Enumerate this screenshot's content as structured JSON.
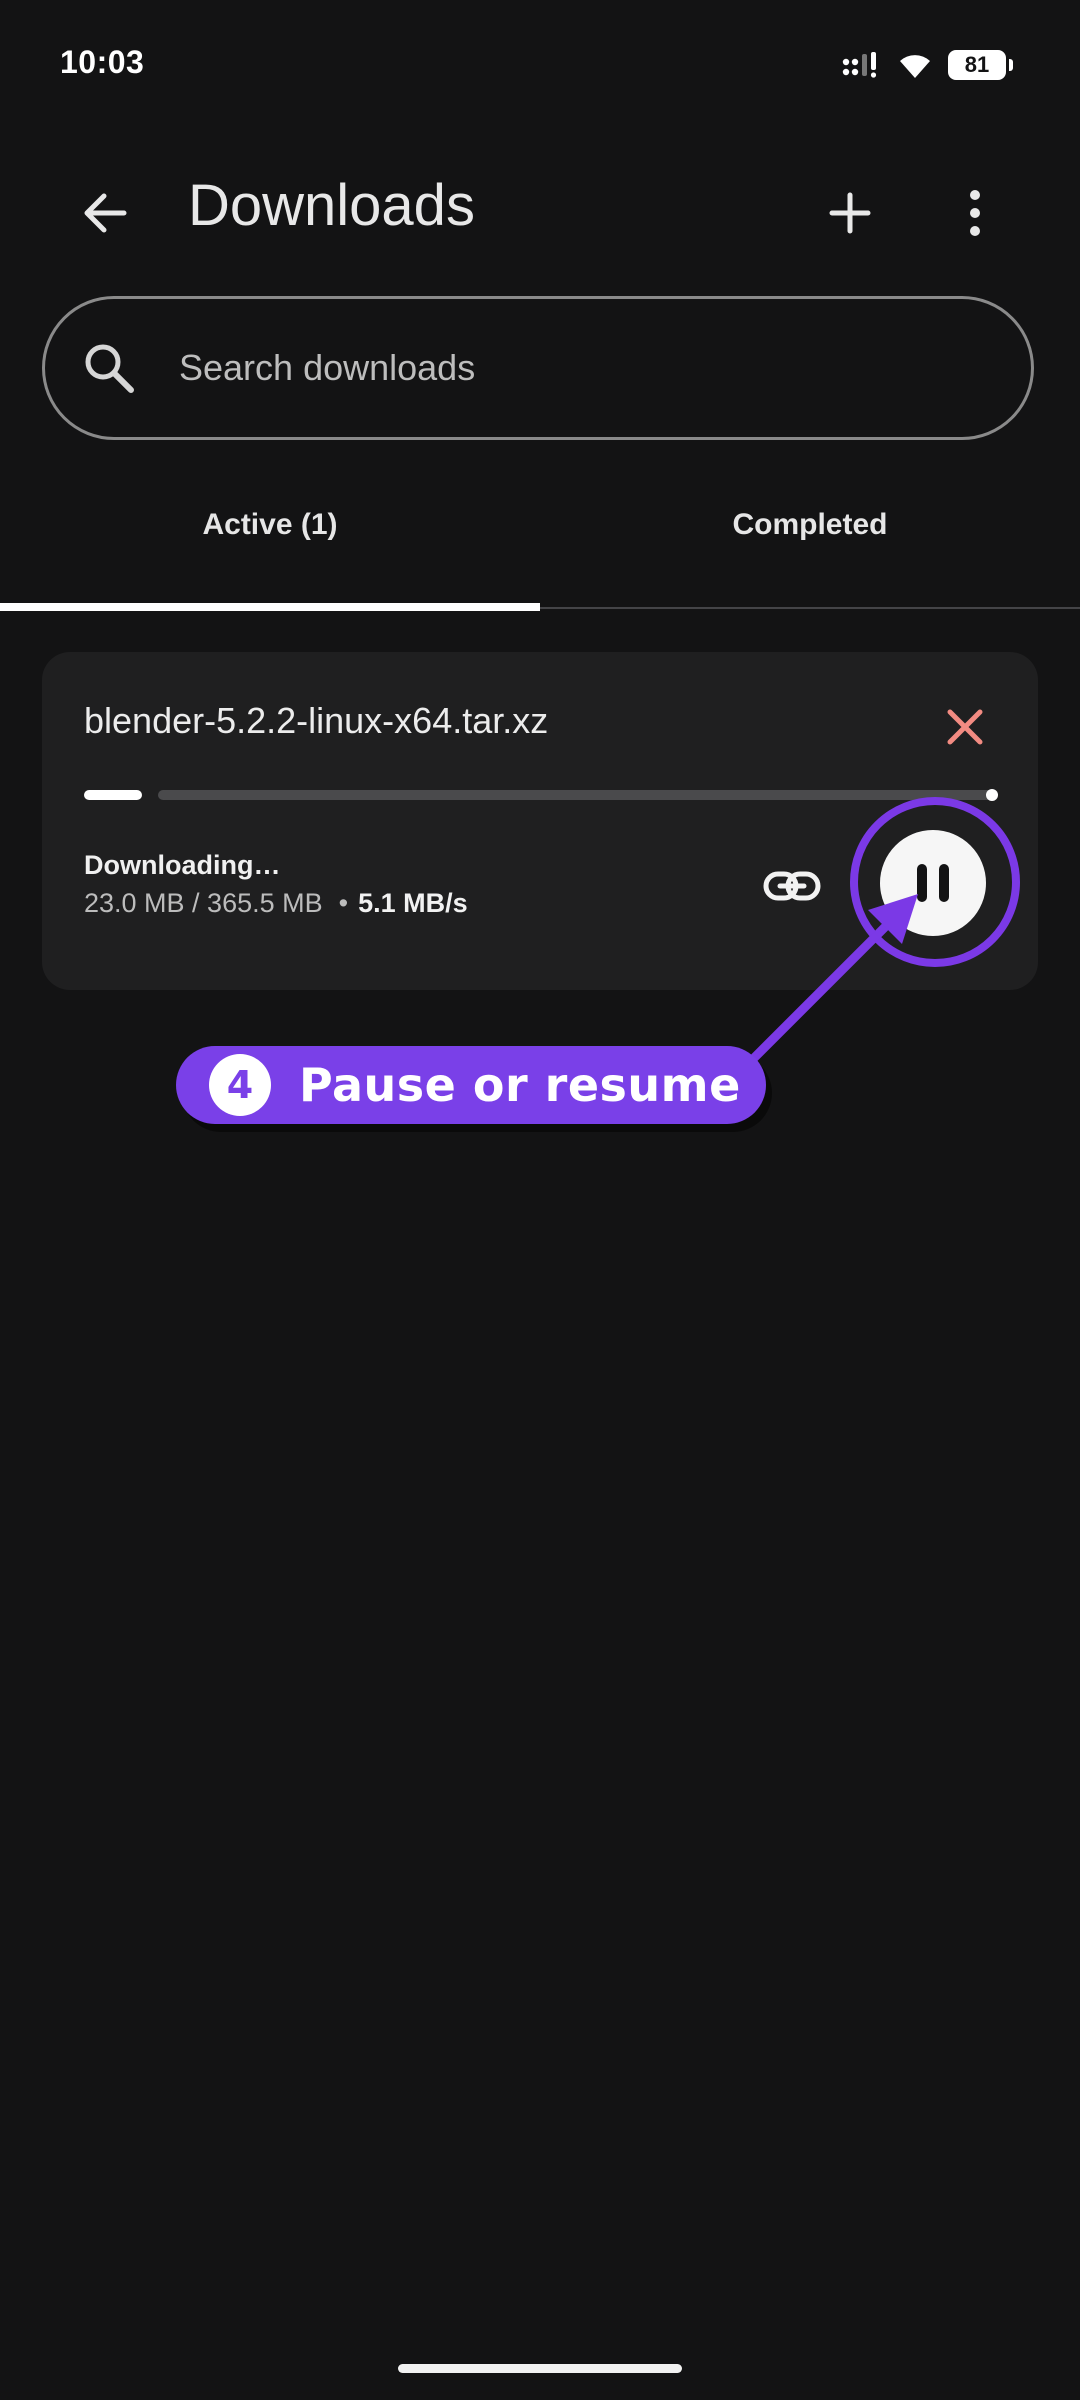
{
  "status_bar": {
    "time": "10:03",
    "battery": "81",
    "icons": [
      "signal-icon",
      "wifi-icon",
      "battery-icon"
    ]
  },
  "app_bar": {
    "title": "Downloads",
    "back_icon": "arrow-back-icon",
    "add_icon": "plus-icon",
    "more_icon": "more-vert-icon"
  },
  "search": {
    "placeholder": "Search downloads",
    "value": "",
    "icon": "search-icon"
  },
  "tabs": [
    {
      "label": "Active (1)",
      "selected": true
    },
    {
      "label": "Completed",
      "selected": false
    }
  ],
  "download": {
    "file_name": "blender-5.2.2-linux-x64.tar.xz",
    "status": "Downloading…",
    "size_progress": "23.0 MB / 365.5 MB",
    "speed": "5.1 MB/s",
    "progress_fraction": 0.063,
    "close_icon_color": "#f28b82"
  },
  "annotation": {
    "step": "4",
    "label": "Pause or resume",
    "color": "#7a40e8"
  }
}
